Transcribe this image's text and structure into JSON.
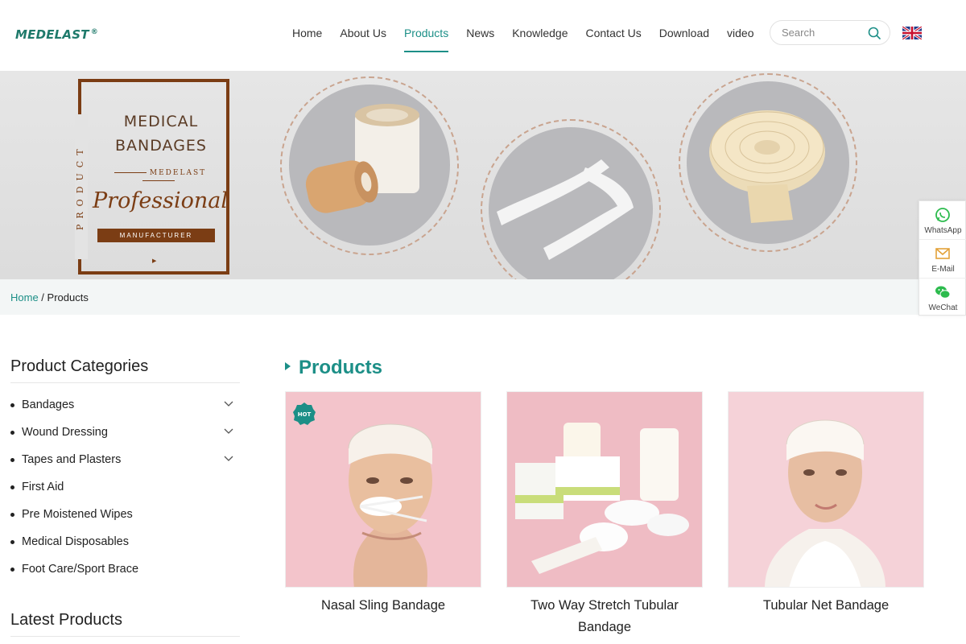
{
  "header": {
    "logo": "MEDELAST",
    "logo_mark": "®",
    "nav": [
      "Home",
      "About Us",
      "Products",
      "News",
      "Knowledge",
      "Contact Us",
      "Download",
      "video"
    ],
    "active_nav": "Products",
    "search_placeholder": "Search",
    "language_flag": "uk-flag-icon"
  },
  "banner": {
    "vertical_text": "PRODUCT",
    "title_line1": "MEDICAL",
    "title_line2": "BANDAGES",
    "brand": "MEDELAST",
    "script": "Professional",
    "manufacturer": "MANUFACTURER"
  },
  "breadcrumb": {
    "home": "Home",
    "separator": " / ",
    "current": "Products"
  },
  "float_contact": [
    {
      "label": "WhatsApp",
      "icon": "whatsapp-icon"
    },
    {
      "label": "E-Mail",
      "icon": "email-icon"
    },
    {
      "label": "WeChat",
      "icon": "wechat-icon"
    }
  ],
  "sidebar": {
    "title": "Product Categories",
    "categories": [
      {
        "label": "Bandages",
        "expandable": true
      },
      {
        "label": "Wound Dressing",
        "expandable": true
      },
      {
        "label": "Tapes and Plasters",
        "expandable": true
      },
      {
        "label": "First Aid",
        "expandable": false
      },
      {
        "label": "Pre Moistened Wipes",
        "expandable": false
      },
      {
        "label": "Medical Disposables",
        "expandable": false
      },
      {
        "label": "Foot Care/Sport Brace",
        "expandable": false
      }
    ],
    "latest_title": "Latest Products"
  },
  "products": {
    "heading": "Products",
    "items": [
      {
        "name": "Nasal Sling Bandage",
        "badge": "HOT"
      },
      {
        "name": "Two Way Stretch Tubular Bandage",
        "badge": ""
      },
      {
        "name": "Tubular Net Bandage",
        "badge": ""
      }
    ]
  },
  "colors": {
    "accent": "#1c8f87",
    "banner_brown": "#7b3d14",
    "product_bg": "#f6c7cd"
  }
}
